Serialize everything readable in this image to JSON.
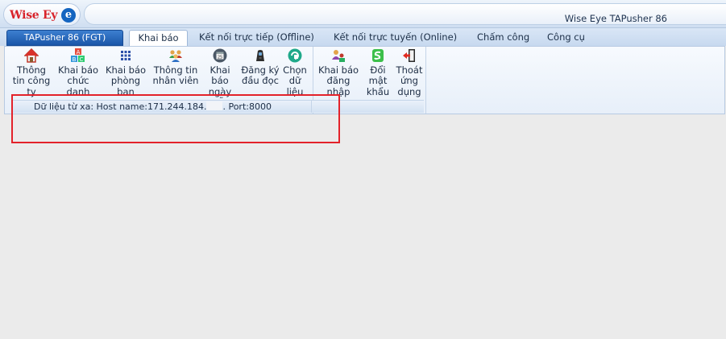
{
  "window": {
    "logo_text": "Wise Ey",
    "logo_e": "e",
    "title": "Wise Eye TAPusher 86"
  },
  "tabs": {
    "app_menu": "TAPusher 86 (FGT)",
    "items": [
      {
        "label": "Khai báo",
        "active": true
      },
      {
        "label": "Kết nối trực tiếp (Offline)",
        "active": false
      },
      {
        "label": "Kết nối trực tuyến (Online)",
        "active": false
      },
      {
        "label": "Chấm công",
        "active": false
      },
      {
        "label": "Công cụ",
        "active": false
      }
    ]
  },
  "ribbon": {
    "buttons": [
      {
        "label": "Thông tin công ty",
        "icon": "home-icon"
      },
      {
        "label": "Khai báo chức danh",
        "icon": "abc-blocks-icon"
      },
      {
        "label": "Khai báo phòng ban",
        "icon": "grid-icon"
      },
      {
        "label": "Thông tin nhân viên",
        "icon": "people-group-icon"
      },
      {
        "label": "Khai báo ngày lễ",
        "icon": "calendar-icon"
      },
      {
        "label": "Đăng ký đầu đọc",
        "icon": "fingerprint-reader-icon"
      },
      {
        "label": "Chọn dữ liệu",
        "icon": "database-select-icon"
      },
      {
        "label": "Khai báo đăng nhập",
        "icon": "user-login-icon"
      },
      {
        "label": "Đổi mật khẩu",
        "icon": "change-password-icon"
      },
      {
        "label": "Thoát ứng dụng",
        "icon": "exit-door-icon"
      }
    ]
  },
  "status": {
    "prefix": "Dữ liệu từ xa: Host name:171.244.184.",
    "suffix": ". Port:8000"
  },
  "colors": {
    "logo_red": "#d8232a",
    "logo_blue": "#1565c0",
    "app_tab_blue": "#1a56a8",
    "highlight_red": "#e3222a",
    "workspace": "#ebebeb"
  }
}
